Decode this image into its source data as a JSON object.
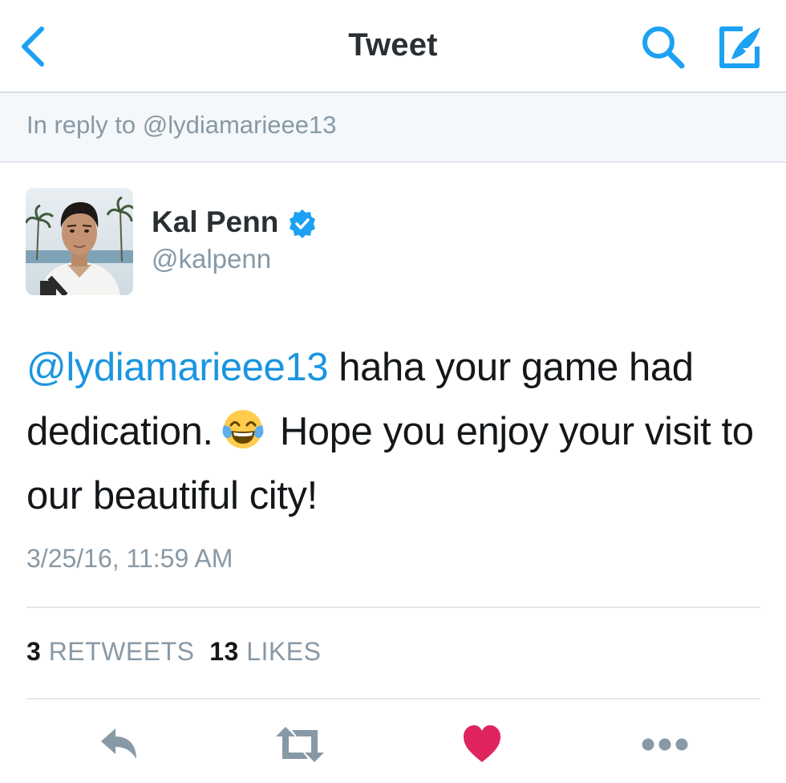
{
  "nav": {
    "title": "Tweet",
    "back_icon": "chevron-left-icon",
    "search_icon": "search-icon",
    "compose_icon": "compose-tweet-icon"
  },
  "reply_context": {
    "prefix": "In reply to ",
    "handle": "@lydiamarieee13"
  },
  "author": {
    "name": "Kal Penn",
    "handle": "@kalpenn",
    "verified": true
  },
  "tweet": {
    "mention": "@lydiamarieee13",
    "text_part1": " haha your game had dedication.",
    "emoji": "face-with-tears-of-joy",
    "text_part2": " Hope you enjoy your visit to our beautiful city!",
    "timestamp": "3/25/16, 11:59 AM"
  },
  "stats": {
    "retweets_count": "3",
    "retweets_label": "RETWEETS",
    "likes_count": "13",
    "likes_label": "LIKES"
  },
  "actions": [
    "reply-icon",
    "retweet-icon",
    "like-heart-icon",
    "more-icon"
  ],
  "colors": {
    "accent": "#1b95e0",
    "muted": "#8899a6",
    "like": "#e0245e",
    "action_icon": "#8899a6"
  }
}
